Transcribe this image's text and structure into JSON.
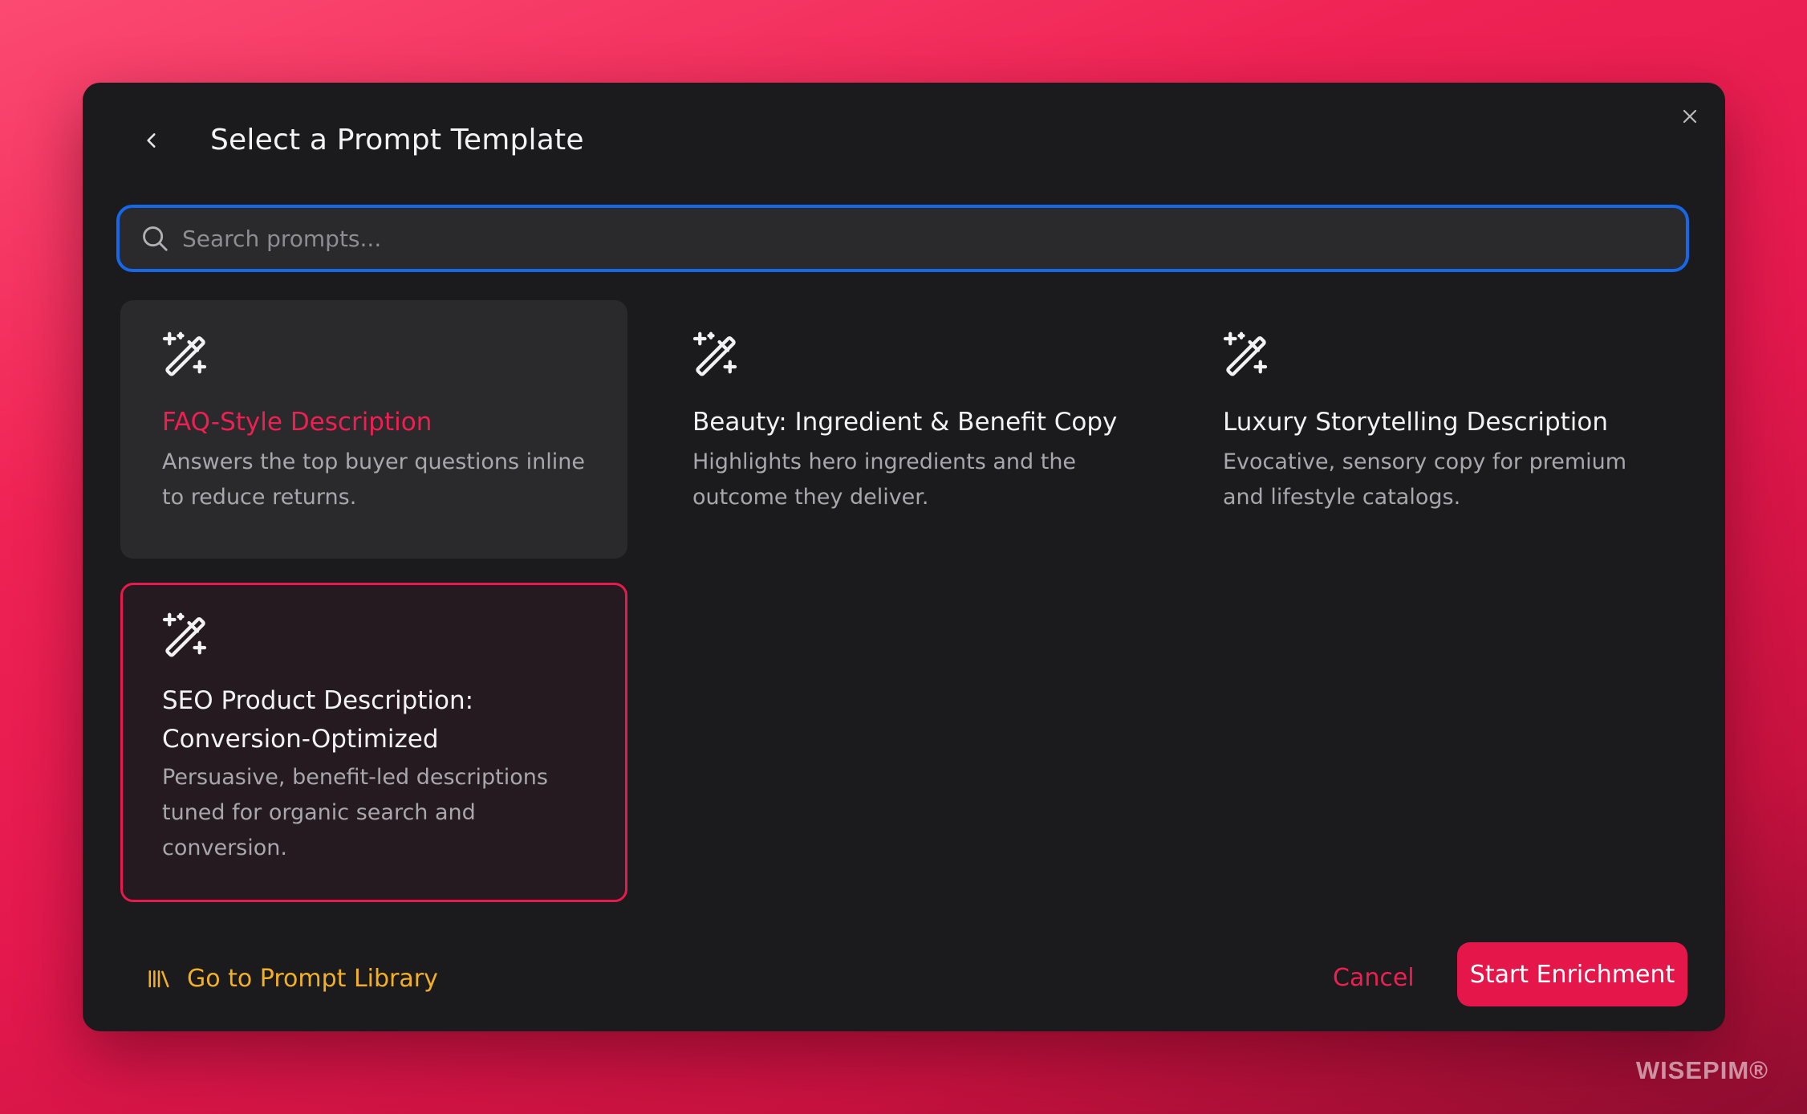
{
  "dialog": {
    "title": "Select a Prompt Template",
    "back_icon": "chevron-left-icon",
    "close_icon": "close-icon"
  },
  "search": {
    "placeholder": "Search prompts...",
    "value": "",
    "icon": "search-icon"
  },
  "templates": [
    {
      "title": "FAQ-Style Description",
      "description": "Answers the top buyer questions inline to reduce returns.",
      "icon": "magic-wand-icon",
      "state": "hovered"
    },
    {
      "title": "Beauty: Ingredient & Benefit Copy",
      "description": "Highlights hero ingredients and the outcome they deliver.",
      "icon": "magic-wand-icon",
      "state": "default"
    },
    {
      "title": "Luxury Storytelling Description",
      "description": "Evocative, sensory copy for premium and lifestyle catalogs.",
      "icon": "magic-wand-icon",
      "state": "default"
    },
    {
      "title": "SEO Product Description: Conversion-Optimized",
      "description": "Persuasive, benefit-led descriptions tuned for organic search and conversion.",
      "icon": "magic-wand-icon",
      "state": "selected"
    }
  ],
  "footer": {
    "library_link": "Go to Prompt Library",
    "library_icon": "library-icon",
    "cancel_label": "Cancel",
    "primary_label": "Start Enrichment"
  },
  "brand": {
    "watermark": "WISEPIM®"
  },
  "colors": {
    "accent": "#e5164a",
    "focus_ring": "#1668e8",
    "link": "#f3b024",
    "modal_bg": "#1b1b1e"
  }
}
